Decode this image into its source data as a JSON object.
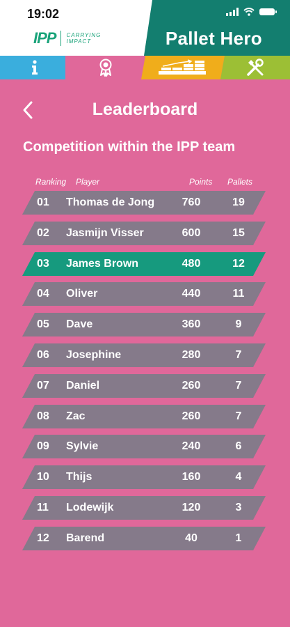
{
  "status_bar": {
    "time": "19:02"
  },
  "header": {
    "logo_mark": "IPP",
    "logo_tag_line1": "CARRYING",
    "logo_tag_line2": "IMPACT",
    "app_title": "Pallet Hero"
  },
  "tabs": [
    {
      "icon": "info-icon",
      "color": "#3aaedd"
    },
    {
      "icon": "medal-icon",
      "color": "#e0689a",
      "active": true
    },
    {
      "icon": "pallet-stack-icon",
      "color": "#f0ad1b"
    },
    {
      "icon": "tools-icon",
      "color": "#9cbf35"
    }
  ],
  "page": {
    "title": "Leaderboard",
    "subtitle": "Competition within the IPP team"
  },
  "table": {
    "headers": {
      "ranking": "Ranking",
      "player": "Player",
      "points": "Points",
      "pallets": "Pallets"
    },
    "rows": [
      {
        "rank": "01",
        "player": "Thomas de Jong",
        "points": "760",
        "pallets": "19"
      },
      {
        "rank": "02",
        "player": "Jasmijn Visser",
        "points": "600",
        "pallets": "15"
      },
      {
        "rank": "03",
        "player": "James Brown",
        "points": "480",
        "pallets": "12",
        "highlight": true
      },
      {
        "rank": "04",
        "player": "Oliver",
        "points": "440",
        "pallets": "11"
      },
      {
        "rank": "05",
        "player": "Dave",
        "points": "360",
        "pallets": "9"
      },
      {
        "rank": "06",
        "player": "Josephine",
        "points": "280",
        "pallets": "7"
      },
      {
        "rank": "07",
        "player": "Daniel",
        "points": "260",
        "pallets": "7"
      },
      {
        "rank": "08",
        "player": "Zac",
        "points": "260",
        "pallets": "7"
      },
      {
        "rank": "09",
        "player": "Sylvie",
        "points": "240",
        "pallets": "6"
      },
      {
        "rank": "10",
        "player": "Thijs",
        "points": "160",
        "pallets": "4"
      },
      {
        "rank": "11",
        "player": "Lodewijk",
        "points": "120",
        "pallets": "3"
      },
      {
        "rank": "12",
        "player": "Barend",
        "points": "40",
        "pallets": "1"
      }
    ]
  },
  "colors": {
    "background": "#e0689a",
    "brand_green": "#137e6f",
    "row": "#857a8a",
    "row_highlight": "#169a7e"
  }
}
